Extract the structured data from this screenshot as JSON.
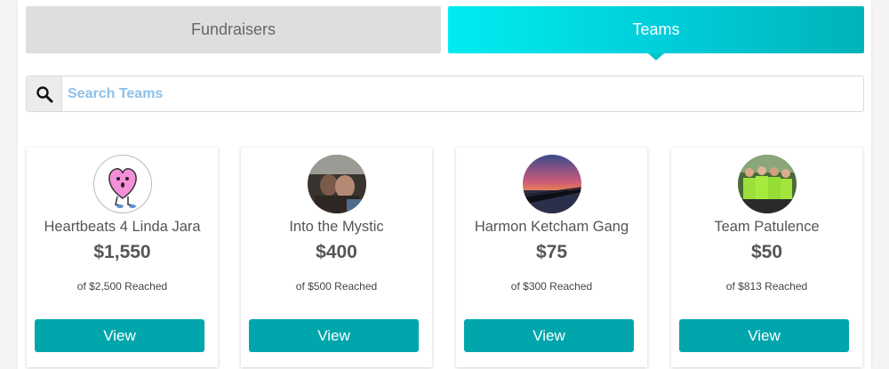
{
  "tabs": {
    "fundraisers_label": "Fundraisers",
    "teams_label": "Teams",
    "active": "Teams"
  },
  "search": {
    "placeholder": "Search Teams",
    "value": "",
    "icon": "search-icon"
  },
  "colors": {
    "accent": "#00a6ac",
    "active_tab": "#00d8e2",
    "inactive_tab": "#dedede",
    "placeholder": "#8dc0ea"
  },
  "teams": [
    {
      "name": "Heartbeats 4 Linda Jara",
      "raised": "$1,550",
      "goal": "of $2,500 Reached",
      "button": "View",
      "avatar": "pink-heart-mascot-image"
    },
    {
      "name": "Into the Mystic",
      "raised": "$400",
      "goal": "of $500 Reached",
      "button": "View",
      "avatar": "couple-photo-image"
    },
    {
      "name": "Harmon Ketcham Gang",
      "raised": "$75",
      "goal": "of $300 Reached",
      "button": "View",
      "avatar": "pier-sunset-image"
    },
    {
      "name": "Team Patulence",
      "raised": "$50",
      "goal": "of $813 Reached",
      "button": "View",
      "avatar": "runners-group-image"
    }
  ]
}
